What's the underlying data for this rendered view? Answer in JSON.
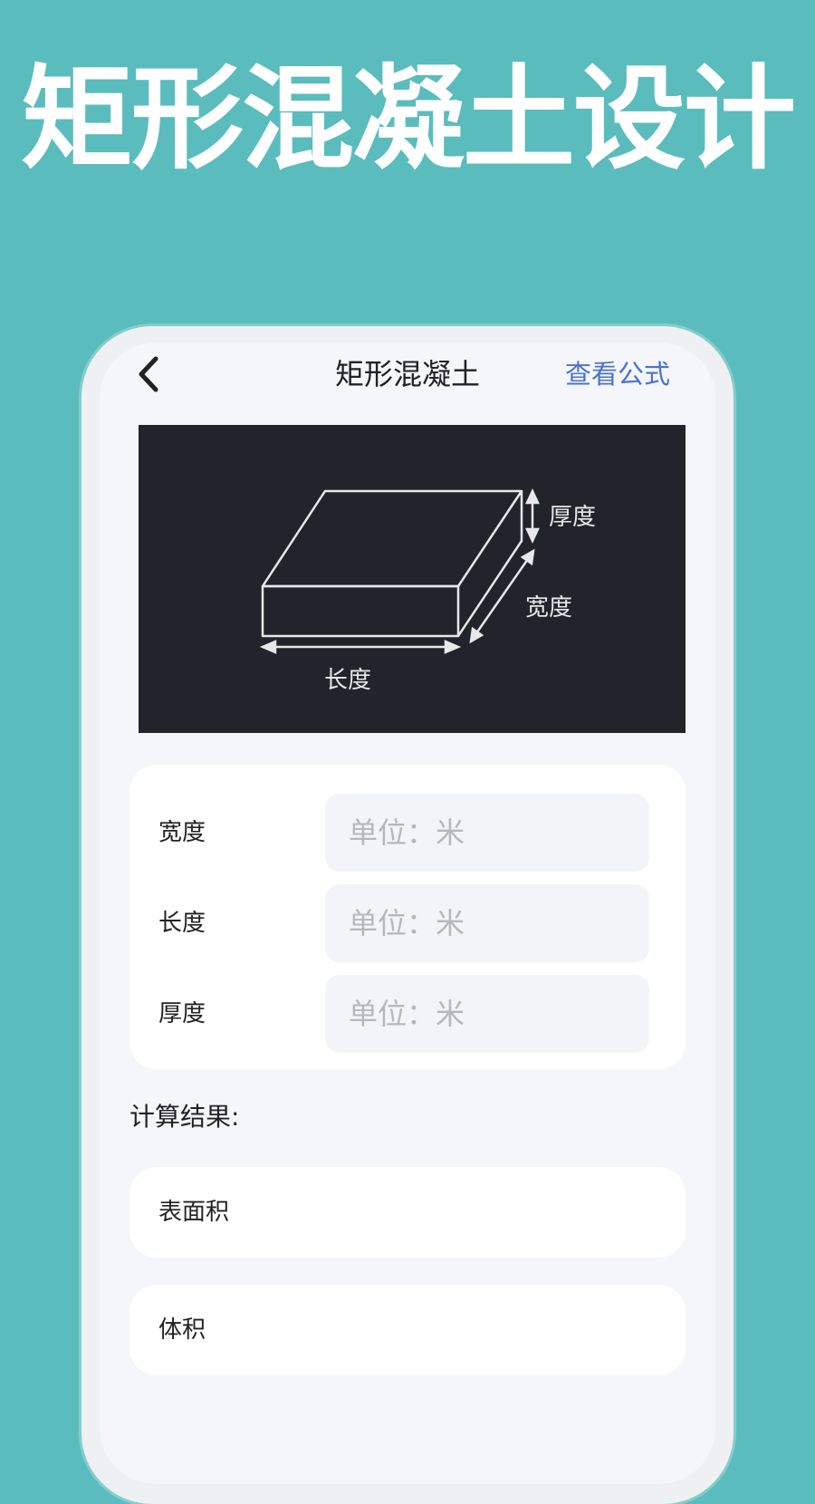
{
  "promo": {
    "title": "矩形混凝土设计"
  },
  "nav": {
    "title": "矩形混凝土",
    "formula_link": "查看公式"
  },
  "diagram": {
    "thickness_label": "厚度",
    "width_label": "宽度",
    "length_label": "长度"
  },
  "inputs": [
    {
      "label": "宽度",
      "placeholder": "单位：米",
      "value": ""
    },
    {
      "label": "长度",
      "placeholder": "单位：米",
      "value": ""
    },
    {
      "label": "厚度",
      "placeholder": "单位：米",
      "value": ""
    }
  ],
  "results": {
    "heading": "计算结果:",
    "items": [
      {
        "label": "表面积",
        "value": ""
      },
      {
        "label": "体积",
        "value": ""
      }
    ]
  },
  "colors": {
    "background": "#5bbcbd",
    "accent_link": "#4a72d0",
    "diagram_bg": "#22242c"
  }
}
